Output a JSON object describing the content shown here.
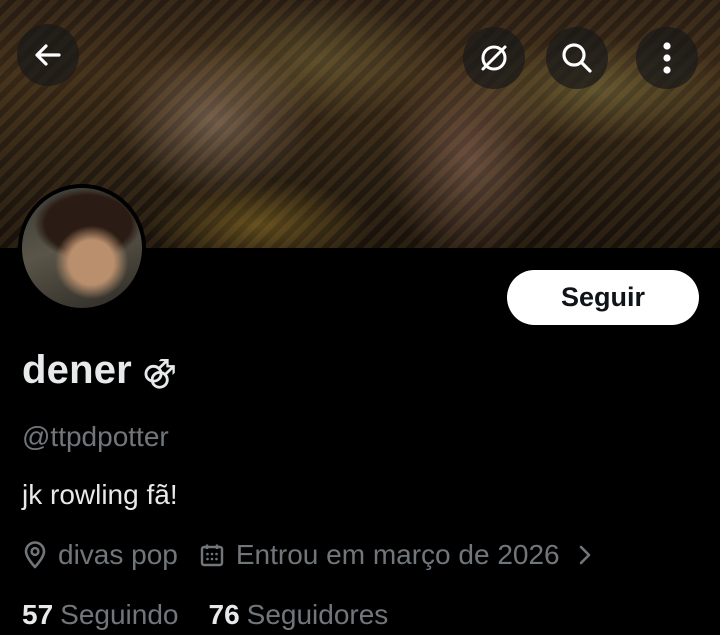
{
  "header": {
    "back_icon": "arrow-left-icon",
    "grok_icon": "grok-icon",
    "search_icon": "search-icon",
    "more_icon": "more-vertical-icon"
  },
  "profile": {
    "follow_label": "Seguir",
    "display_name": "dener",
    "name_symbol": "⚣",
    "handle": "@ttpdpotter",
    "bio": "jk rowling fã!",
    "location": "divas pop",
    "joined": "Entrou em março de 2026",
    "following_count": "57",
    "following_label": "Seguindo",
    "followers_count": "76",
    "followers_label": "Seguidores"
  },
  "colors": {
    "background": "#000000",
    "primary_text": "#e7e9ea",
    "secondary_text": "#71767b",
    "button_bg": "#ffffff",
    "button_text": "#0f1419"
  }
}
